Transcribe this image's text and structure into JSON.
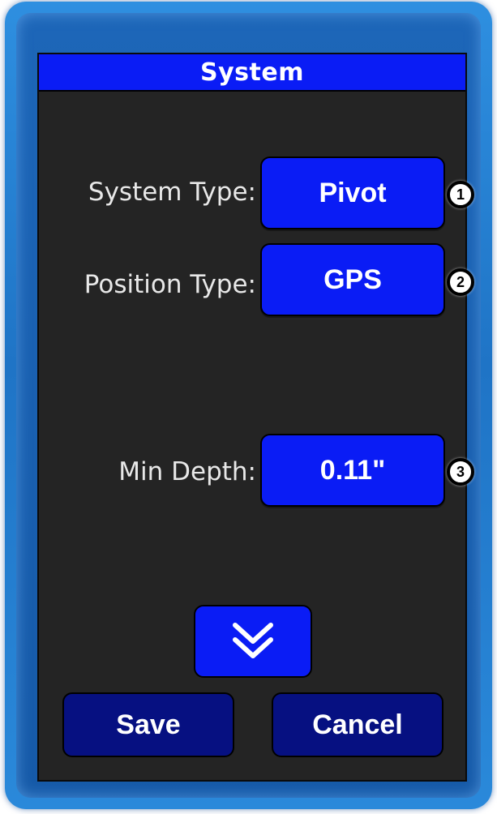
{
  "window": {
    "title": "System"
  },
  "fields": [
    {
      "label": "System Type:",
      "value": "Pivot",
      "marker": "1"
    },
    {
      "label": "Position Type:",
      "value": "GPS",
      "marker": "2"
    },
    {
      "label": "Min Depth:",
      "value": "0.11\"",
      "marker": "3"
    }
  ],
  "scroll": {
    "icon": "double-chevron-down-icon"
  },
  "actions": {
    "save_label": "Save",
    "cancel_label": "Cancel"
  },
  "colors": {
    "accent": "#0a1cf5",
    "action_button": "#061081",
    "screen_background": "#242424",
    "frame": "#1f74c6"
  }
}
